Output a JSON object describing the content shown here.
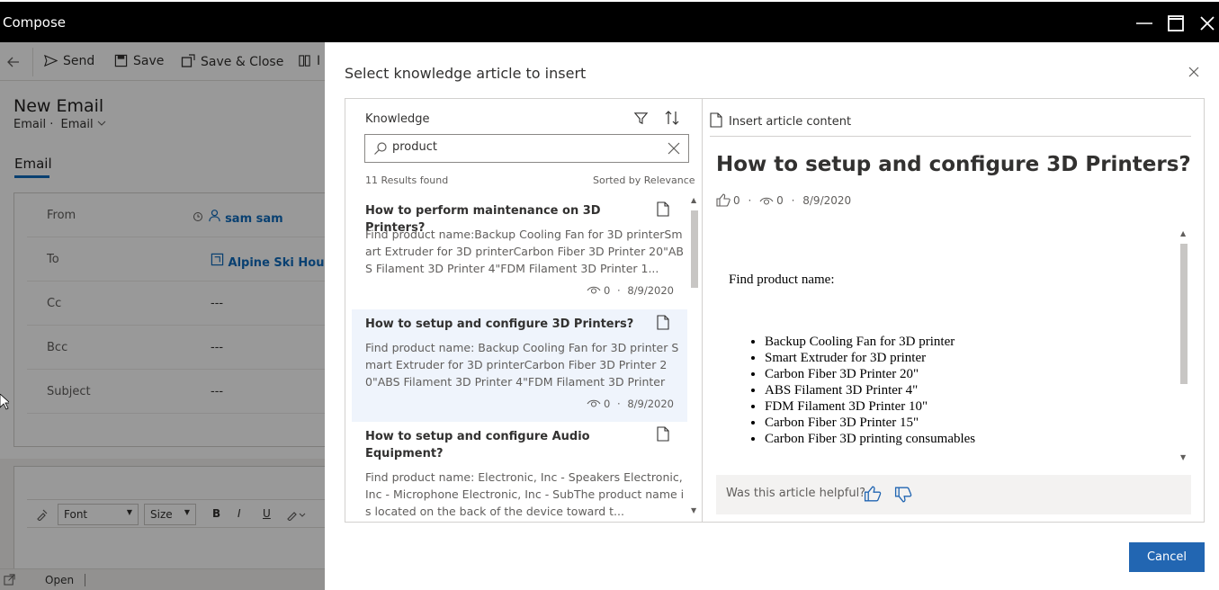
{
  "window": {
    "title": "Compose"
  },
  "toolbar": {
    "send": "Send",
    "save": "Save",
    "save_close": "Save & Close",
    "insert": "I"
  },
  "form": {
    "title": "New Email",
    "entity": "Email ·",
    "form_selector": "Email",
    "tab": "Email",
    "fields": [
      {
        "label": "From",
        "value": "sam sam"
      },
      {
        "label": "To",
        "value": "Alpine Ski House"
      },
      {
        "label": "Cc",
        "value": "---"
      },
      {
        "label": "Bcc",
        "value": "---"
      },
      {
        "label": "Subject",
        "value": "---"
      }
    ],
    "rte": {
      "font": "Font",
      "size": "Size",
      "bold": "B",
      "italic": "I",
      "underline": "U"
    },
    "status": "Open"
  },
  "dialog": {
    "title": "Select knowledge article to insert",
    "knowledge_label": "Knowledge",
    "search_value": "product",
    "results_count": "11 Results found",
    "sorted_by": "Sorted by Relevance",
    "articles": [
      {
        "title": "How to perform maintenance on 3D Printers?",
        "body": "Find product name:Backup Cooling Fan for 3D printerSmart Extruder for 3D printerCarbon Fiber 3D Printer 20\"ABS Filament 3D Printer 4\"FDM Filament 3D Printer 1...",
        "views": "0",
        "date": "8/9/2020"
      },
      {
        "title": "How to setup and configure 3D Printers?",
        "body": " Find product name: Backup Cooling Fan for 3D printer Smart Extruder for 3D printerCarbon Fiber 3D Printer 20\"ABS Filament 3D Printer 4\"FDM Filament 3D Printer 1...",
        "views": "0",
        "date": "8/9/2020"
      },
      {
        "title": "How to setup and configure Audio Equipment?",
        "body": "Find product name:     Electronic, Inc - Speakers     Electronic, Inc - Microphone     Electronic, Inc - SubThe product name is located on the back of the device toward t..."
      }
    ],
    "insert_label": "Insert article content",
    "preview": {
      "title": "How to setup and configure 3D Printers?",
      "likes": "0",
      "views": "0",
      "date": "8/9/2020",
      "find_label": "Find product name:",
      "products": [
        "Backup Cooling Fan for 3D printer",
        "Smart Extruder for 3D printer",
        "Carbon Fiber 3D Printer 20\"",
        "ABS Filament 3D Printer 4\"",
        "FDM Filament 3D Printer 10\"",
        "Carbon Fiber 3D Printer 15\"",
        "Carbon Fiber 3D printing consumables"
      ],
      "helpful_label": "Was this article helpful?"
    },
    "cancel": "Cancel"
  }
}
